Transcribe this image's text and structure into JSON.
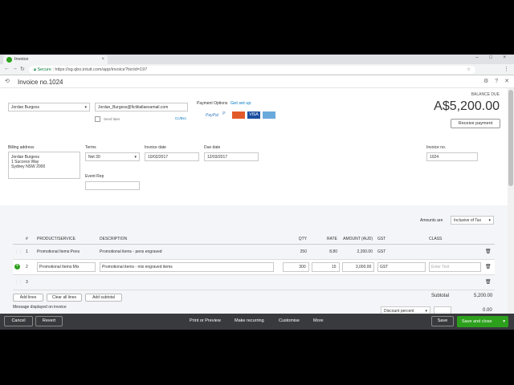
{
  "browser": {
    "tab_title": "Invoice",
    "tab_close": "×",
    "window_controls": "– □ ×",
    "secure_label": "Secure",
    "url": "https://sg.qbo.intuit.com/app/invoice?txnId=197"
  },
  "header": {
    "title": "Invoice no.1024"
  },
  "customer": {
    "name": "Jordan Burgess",
    "email": "Jordan_Burgess@fictitiallaexamail.com",
    "send_later": "Send later",
    "cc_bcc": "Cc/Bcc"
  },
  "payment": {
    "label": "Payment Options",
    "setup_link": "Get set up",
    "methods": [
      "PayPal",
      "P",
      "MC",
      "VISA",
      "AMEX"
    ]
  },
  "balance": {
    "label": "BALANCE DUE",
    "amount": "A$5,200.00",
    "receive_button": "Receive payment"
  },
  "billing": {
    "label": "Billing address",
    "lines": [
      "Jordan Burgess",
      "1 Success Way",
      "Sydney NSW  2000"
    ]
  },
  "terms": {
    "label": "Terms",
    "value": "Net 30"
  },
  "invoice_date": {
    "label": "Invoice date",
    "value": "10/02/2017"
  },
  "due_date": {
    "label": "Due date",
    "value": "12/03/2017"
  },
  "invoice_no": {
    "label": "Invoice no.",
    "value": "1024"
  },
  "event_rep": {
    "label": "Event Rep",
    "value": ""
  },
  "amounts_are": {
    "label": "Amounts are",
    "value": "Inclusive of Tax"
  },
  "table": {
    "headers": [
      "#",
      "PRODUCT/SERVICE",
      "DESCRIPTION",
      "QTY",
      "RATE",
      "AMOUNT (AUD)",
      "GST",
      "CLASS"
    ],
    "rows": [
      {
        "num": "1",
        "product": "Promotional Items:Pens",
        "description": "Promotional items - pens engraved",
        "qty": "250",
        "rate": "8.80",
        "amount": "2,200.00",
        "gst": "GST",
        "class": ""
      },
      {
        "num": "2",
        "product": "Promotional Items:Mix",
        "description": "Promotional items - mix engraved items",
        "qty": "300",
        "rate": "15",
        "amount": "3,000.00",
        "gst": "GST",
        "class": "Enter Text"
      },
      {
        "num": "3",
        "product": "",
        "description": "",
        "qty": "",
        "rate": "",
        "amount": "",
        "gst": "",
        "class": ""
      }
    ]
  },
  "line_actions": {
    "add_lines": "Add lines",
    "clear_lines": "Clear all lines",
    "add_subtotal": "Add subtotal"
  },
  "message_label": "Message displayed on invoice",
  "subtotal": {
    "label": "Subtotal",
    "value": "5,200.00"
  },
  "discount": {
    "label": "Discount percent",
    "value": "0.00"
  },
  "footer": {
    "cancel": "Cancel",
    "revert": "Revert",
    "print": "Print or Preview",
    "recurring": "Make recurring",
    "customise": "Customise",
    "more": "More",
    "save": "Save",
    "save_close": "Save and close"
  }
}
